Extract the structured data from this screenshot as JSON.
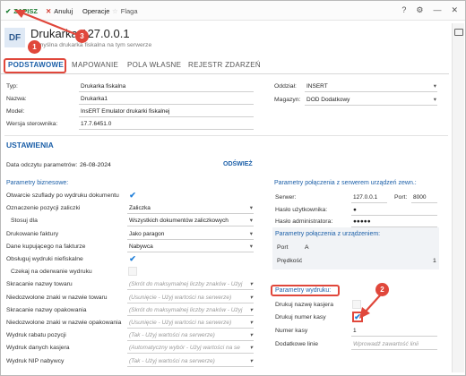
{
  "toolbar": {
    "save": "ZAPISZ",
    "cancel": "Anuluj",
    "operations": "Operacje",
    "flag": "Flaga"
  },
  "header": {
    "badge": "DF",
    "title": "Drukarka 127.0.0.1",
    "subtitle": "Domyślna drukarka fiskalna na tym serwerze"
  },
  "tabs": [
    "PODSTAWOWE",
    "MAPOWANIE",
    "POLA WŁASNE",
    "REJESTR ZDARZEŃ"
  ],
  "basic": {
    "type_label": "Typ:",
    "type_value": "Drukarka fiskalna",
    "name_label": "Nazwa:",
    "name_value": "Drukarka1",
    "model_label": "Model:",
    "model_value": "InsERT Emulator drukarki fiskalnej",
    "driver_label": "Wersja sterownika:",
    "driver_value": "17.7.6451.0",
    "branch_label": "Oddział:",
    "branch_value": "INSERT",
    "warehouse_label": "Magazyn:",
    "warehouse_value": "DOD Dodatkowy"
  },
  "settings": {
    "title": "USTAWIENIA",
    "read_date_label": "Data odczytu parametrów:",
    "read_date_value": "26-08-2024",
    "refresh": "ODŚWIEŻ"
  },
  "business": {
    "title": "Parametry biznesowe:",
    "rows": [
      {
        "label": "Otwarcie szuflady po wydruku dokumentu",
        "kind": "check",
        "value": "✔"
      },
      {
        "label": "Oznaczenie pozycji zaliczki",
        "kind": "select",
        "value": "Zaliczka"
      },
      {
        "label": "Stosuj dla",
        "kind": "select",
        "value": "Wszystkich dokumentów zaliczkowych"
      },
      {
        "label": "Drukowanie faktury",
        "kind": "select",
        "value": "Jako paragon"
      },
      {
        "label": "Dane kupującego na fakturze",
        "kind": "select",
        "value": "Nabywca"
      },
      {
        "label": "Obsługuj wydruki niefiskalne",
        "kind": "check",
        "value": "✔"
      },
      {
        "label": "Czekaj na oderwanie wydruku",
        "kind": "check",
        "value": ""
      },
      {
        "label": "Skracanie nazwy towaru",
        "kind": "select",
        "value": "(Skrót do maksymalnej liczby znaków - Użyj",
        "placeholder": true
      },
      {
        "label": "Niedozwolone znaki w nazwie towaru",
        "kind": "select",
        "value": "(Usunięcie - Użyj wartości na serwerze)",
        "placeholder": true
      },
      {
        "label": "Skracanie nazwy opakowania",
        "kind": "select",
        "value": "(Skrót do maksymalnej liczby znaków - Użyj",
        "placeholder": true
      },
      {
        "label": "Niedozwolone znaki w nazwie opakowania",
        "kind": "select",
        "value": "(Usunięcie - Użyj wartości na serwerze)",
        "placeholder": true
      },
      {
        "label": "Wydruk rabatu pozycji",
        "kind": "select",
        "value": "(Tak - Użyj wartości na serwerze)",
        "placeholder": true
      },
      {
        "label": "Wydruk danych kasjera",
        "kind": "select",
        "value": "(Automatyczny wybór - Użyj wartości na se",
        "placeholder": true
      },
      {
        "label": "Wydruk NIP nabywcy",
        "kind": "select",
        "value": "(Tak - Użyj wartości na serwerze)",
        "placeholder": true
      }
    ]
  },
  "server_conn": {
    "title": "Parametry połączenia z serwerem urządzeń zewn.:",
    "server_label": "Serwer:",
    "server_value": "127.0.0.1",
    "port_label": "Port:",
    "port_value": "8000",
    "user_pw_label": "Hasło użytkownika:",
    "user_pw_value": "●",
    "admin_pw_label": "Hasło administratora:",
    "admin_pw_value": "●●●●●"
  },
  "device_conn": {
    "title": "Parametry połączenia z urządzeniem:",
    "port_label": "Port",
    "port_value": "A",
    "speed_label": "Prędkość",
    "speed_value": "1"
  },
  "print_params": {
    "title": "Parametry wydruku:",
    "cashier_label": "Drukuj nazwę kasjera",
    "cashno_label": "Drukuj numer kasy",
    "cashno_value": "✔",
    "number_label": "Numer kasy",
    "number_value": "1",
    "extra_label": "Dodatkowe linie",
    "extra_placeholder": "Wprowadź zawartość linii"
  },
  "annotations": {
    "step1": "1",
    "step2": "2",
    "step3": "3",
    "color": "#e0473b"
  },
  "colors": {
    "accent": "#1b5fa8",
    "save": "#1e7e34",
    "check": "#1f7fd9"
  }
}
